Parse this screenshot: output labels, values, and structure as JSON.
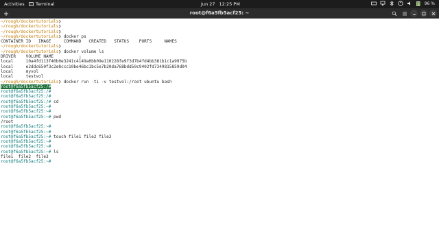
{
  "topbar": {
    "activities": "Activities",
    "app_name": "Terminal",
    "date": "Jun 27",
    "time": "12:25 PM",
    "battery": "96 %"
  },
  "window": {
    "title": "root@f6a5fb5acf25: ~"
  },
  "terminal": {
    "lines": [
      {
        "prompt": "~/rough/dockertutorials",
        "cmd": ""
      },
      {
        "prompt": "~/rough/dockertutorials",
        "cmd": ""
      },
      {
        "prompt": "~/rough/dockertutorials",
        "cmd": ""
      },
      {
        "prompt": "~/rough/dockertutorials",
        "cmd": " docker ps"
      },
      {
        "out": "CONTAINER ID   IMAGE     COMMAND   CREATED   STATUS    PORTS     NAMES"
      },
      {
        "prompt": "~/rough/dockertutorials",
        "cmd": ""
      },
      {
        "prompt": "~/rough/dockertutorials",
        "cmd": " docker volume ls"
      },
      {
        "out": "DRIVER    VOLUME NAME"
      },
      {
        "out": "local     10a4fd113f40b0e3241c4149a0bb09e110228fe9f3d7b4fd4bb381b1c1a9975b"
      },
      {
        "out": "local     e2ddc650f3c2e8ccc10be46bc1bc5e7b20da768bdd50c9402fd7349815859d04"
      },
      {
        "out": "local     myvol"
      },
      {
        "out": "local     testvol"
      },
      {
        "prompt": "~/rough/dockertutorials",
        "cmd": " docker run -ti -v testvol:/root ubuntu bash"
      },
      {
        "root": "root@f6a5fb5acf25:/#",
        "cmd": "",
        "selected": true
      },
      {
        "root": "root@f6a5fb5acf25:/#",
        "cmd": ""
      },
      {
        "root": "root@f6a5fb5acf25:/#",
        "cmd": ""
      },
      {
        "root": "root@f6a5fb5acf25:/#",
        "cmd": " cd"
      },
      {
        "root": "root@f6a5fb5acf25:~#",
        "cmd": ""
      },
      {
        "root": "root@f6a5fb5acf25:~#",
        "cmd": ""
      },
      {
        "root": "root@f6a5fb5acf25:~#",
        "cmd": " pwd"
      },
      {
        "out": "/root"
      },
      {
        "root": "root@f6a5fb5acf25:~#",
        "cmd": ""
      },
      {
        "root": "root@f6a5fb5acf25:~#",
        "cmd": ""
      },
      {
        "root": "root@f6a5fb5acf25:~#",
        "cmd": " touch file1 file2 file3"
      },
      {
        "root": "root@f6a5fb5acf25:~#",
        "cmd": ""
      },
      {
        "root": "root@f6a5fb5acf25:~#",
        "cmd": ""
      },
      {
        "root": "root@f6a5fb5acf25:~#",
        "cmd": " ls"
      },
      {
        "out": "file1  file2  file3"
      },
      {
        "root": "root@f6a5fb5acf25:~#",
        "cmd": ""
      }
    ]
  }
}
